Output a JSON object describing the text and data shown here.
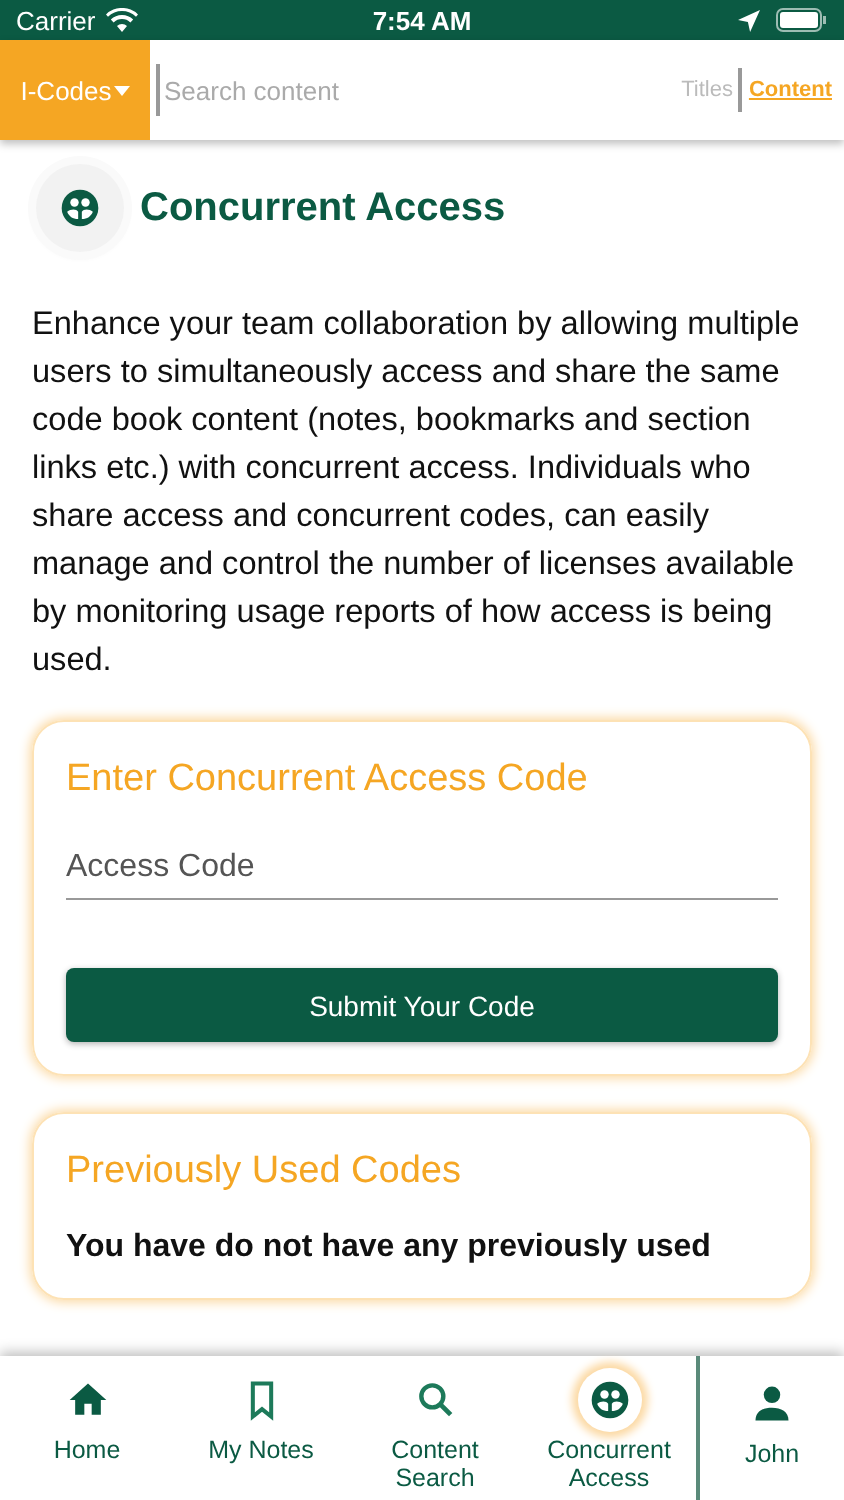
{
  "status_bar": {
    "carrier": "Carrier",
    "time": "7:54 AM"
  },
  "header": {
    "brand_menu": "I-Codes",
    "search": {
      "placeholder": "Search content"
    },
    "scopes": [
      {
        "label": "Titles",
        "selected": false
      },
      {
        "label": "Content",
        "selected": true
      }
    ]
  },
  "page": {
    "title": "Concurrent Access",
    "description": "Enhance your team collaboration by allowing multiple users to simultaneously access and share the same code book content (notes, bookmarks and section links etc.) with concurrent access. Individuals who share access and concurrent codes, can easily manage and control the number of licenses available by monitoring usage reports of how access is being used."
  },
  "code_card": {
    "title": "Enter Concurrent Access Code",
    "field": {
      "placeholder": "Access Code"
    },
    "button": "Submit Your Code"
  },
  "history_card": {
    "title": "Previously Used Codes",
    "message": "You have do not have any previously used"
  },
  "tab_bar": [
    {
      "kind": "home",
      "label": "Home",
      "selected": false
    },
    {
      "kind": "notes",
      "label": "My Notes",
      "selected": false
    },
    {
      "kind": "search",
      "label": "Content Search",
      "selected": false
    },
    {
      "kind": "access",
      "label": "Concurrent Access",
      "selected": true
    },
    {
      "kind": "user",
      "label": "John",
      "selected": false
    }
  ]
}
